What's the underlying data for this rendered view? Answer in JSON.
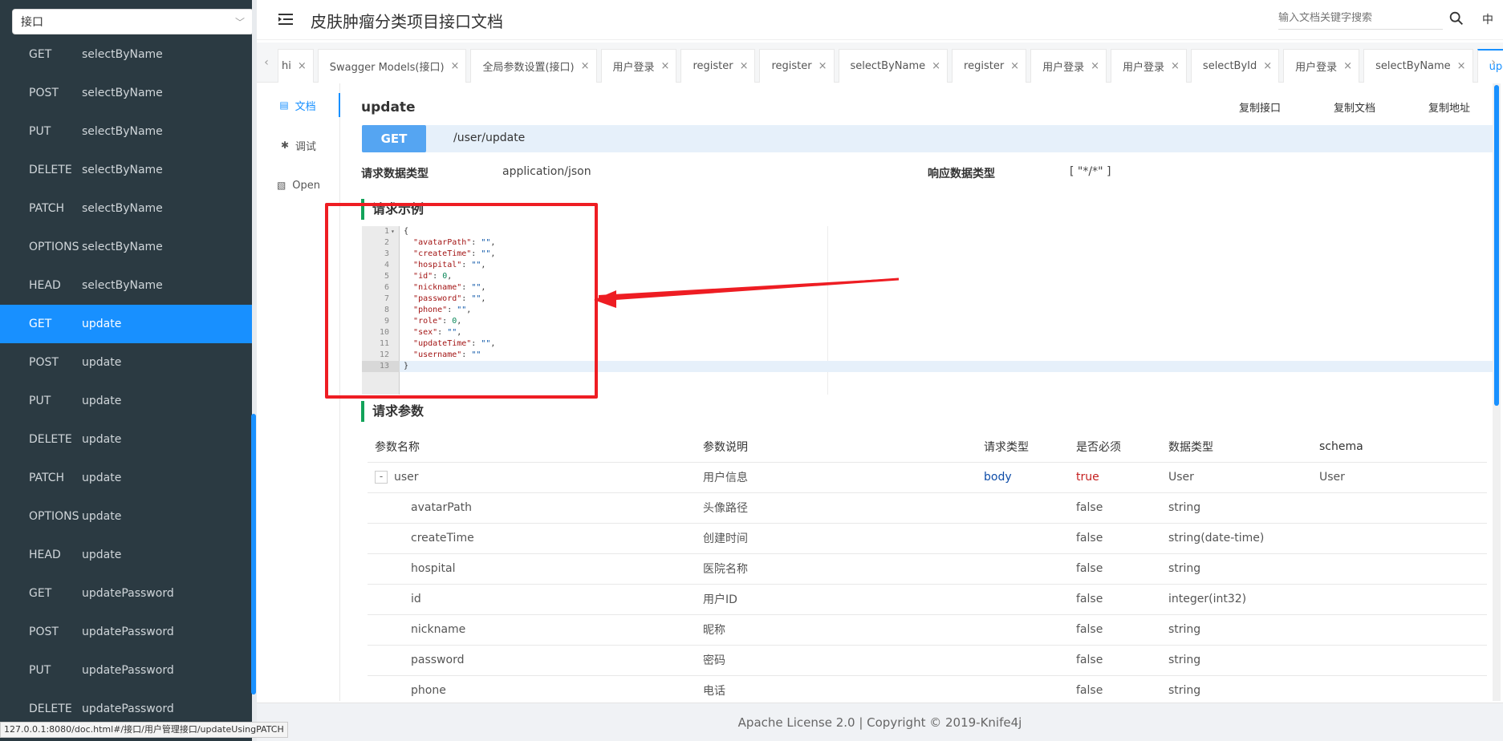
{
  "sidebar": {
    "group_select": "接口",
    "items": [
      {
        "method": "GET",
        "name": "selectByName"
      },
      {
        "method": "POST",
        "name": "selectByName"
      },
      {
        "method": "PUT",
        "name": "selectByName"
      },
      {
        "method": "DELETE",
        "name": "selectByName"
      },
      {
        "method": "PATCH",
        "name": "selectByName"
      },
      {
        "method": "OPTIONS",
        "name": "selectByName"
      },
      {
        "method": "HEAD",
        "name": "selectByName"
      },
      {
        "method": "GET",
        "name": "update",
        "active": true
      },
      {
        "method": "POST",
        "name": "update"
      },
      {
        "method": "PUT",
        "name": "update"
      },
      {
        "method": "DELETE",
        "name": "update"
      },
      {
        "method": "PATCH",
        "name": "update"
      },
      {
        "method": "OPTIONS",
        "name": "update"
      },
      {
        "method": "HEAD",
        "name": "update"
      },
      {
        "method": "GET",
        "name": "updatePassword"
      },
      {
        "method": "POST",
        "name": "updatePassword"
      },
      {
        "method": "PUT",
        "name": "updatePassword"
      },
      {
        "method": "DELETE",
        "name": "updatePassword"
      }
    ]
  },
  "header": {
    "title": "皮肤肿瘤分类项目接口文档",
    "search_placeholder": "输入文档关键字搜索",
    "lang": "中"
  },
  "tabs": [
    {
      "label": "hi"
    },
    {
      "label": "Swagger Models(接口)"
    },
    {
      "label": "全局参数设置(接口)"
    },
    {
      "label": "用户登录"
    },
    {
      "label": "register"
    },
    {
      "label": "register"
    },
    {
      "label": "selectByName"
    },
    {
      "label": "register"
    },
    {
      "label": "用户登录"
    },
    {
      "label": "用户登录"
    },
    {
      "label": "selectById"
    },
    {
      "label": "用户登录"
    },
    {
      "label": "selectByName"
    },
    {
      "label": "update",
      "active": true
    }
  ],
  "doc_nav": {
    "doc": "文档",
    "debug": "调试",
    "open": "Open"
  },
  "api": {
    "name": "update",
    "copy_api": "复制接口",
    "copy_doc": "复制文档",
    "copy_addr": "复制地址",
    "method": "GET",
    "path": "/user/update",
    "req_type_label": "请求数据类型",
    "req_type_value": "application/json",
    "resp_type_label": "响应数据类型",
    "resp_type_value": "[ \"*/*\" ]"
  },
  "request_example": {
    "title": "请求示例",
    "lines": [
      "{",
      "  \"avatarPath\": \"\",",
      "  \"createTime\": \"\",",
      "  \"hospital\": \"\",",
      "  \"id\": 0,",
      "  \"nickname\": \"\",",
      "  \"password\": \"\",",
      "  \"phone\": \"\",",
      "  \"role\": 0,",
      "  \"sex\": \"\",",
      "  \"updateTime\": \"\",",
      "  \"username\": \"\"",
      "}"
    ]
  },
  "params": {
    "title": "请求参数",
    "columns": [
      "参数名称",
      "参数说明",
      "请求类型",
      "是否必须",
      "数据类型",
      "schema"
    ],
    "rows": [
      {
        "name": "user",
        "desc": "用户信息",
        "in": "body",
        "required": "true",
        "type": "User",
        "schema": "User",
        "expander": "-",
        "parent": true
      },
      {
        "name": "avatarPath",
        "desc": "头像路径",
        "in": "",
        "required": "false",
        "type": "string",
        "schema": ""
      },
      {
        "name": "createTime",
        "desc": "创建时间",
        "in": "",
        "required": "false",
        "type": "string(date-time)",
        "schema": ""
      },
      {
        "name": "hospital",
        "desc": "医院名称",
        "in": "",
        "required": "false",
        "type": "string",
        "schema": ""
      },
      {
        "name": "id",
        "desc": "用户ID",
        "in": "",
        "required": "false",
        "type": "integer(int32)",
        "schema": ""
      },
      {
        "name": "nickname",
        "desc": "昵称",
        "in": "",
        "required": "false",
        "type": "string",
        "schema": ""
      },
      {
        "name": "password",
        "desc": "密码",
        "in": "",
        "required": "false",
        "type": "string",
        "schema": ""
      },
      {
        "name": "phone",
        "desc": "电话",
        "in": "",
        "required": "false",
        "type": "string",
        "schema": ""
      }
    ]
  },
  "footer": "Apache License 2.0 | Copyright © 2019-Knife4j",
  "status_url": "127.0.0.1:8080/doc.html#/接口/用户管理接口/updateUsingPATCH",
  "colors": {
    "accent": "#1890ff",
    "sidebar_bg": "#2b3a42",
    "annotation": "#ee1d23",
    "section_mark": "#12a35a"
  }
}
